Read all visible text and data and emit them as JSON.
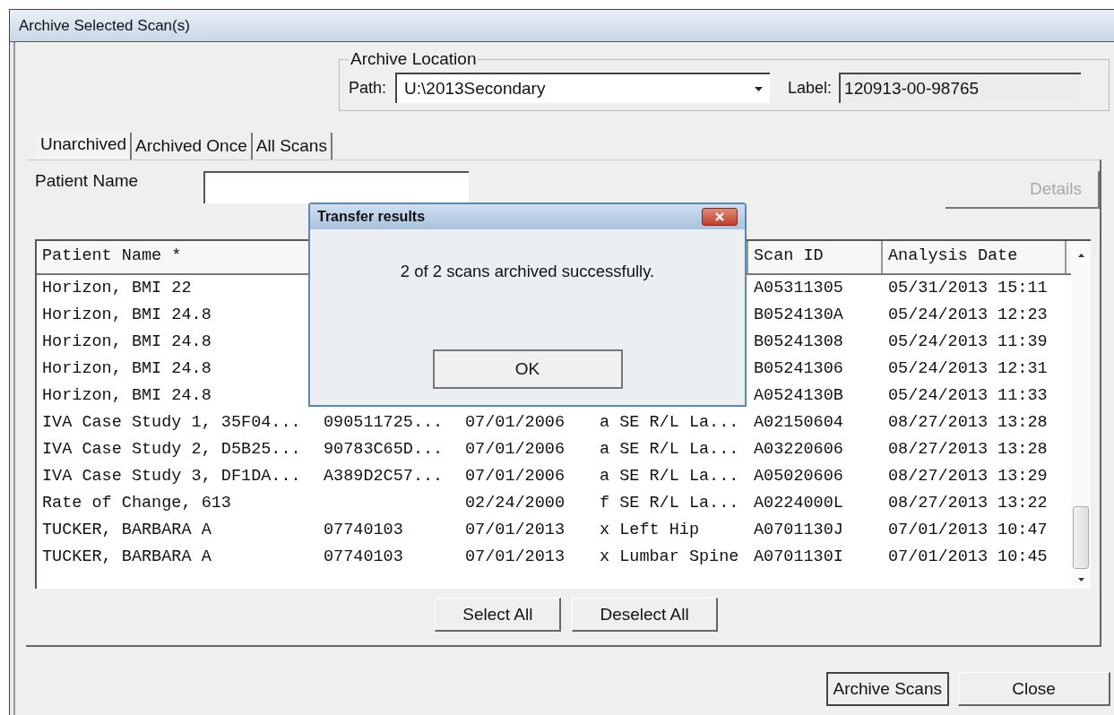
{
  "window": {
    "title": "Archive Selected Scan(s)"
  },
  "archive_location": {
    "title": "Archive Location",
    "path_label": "Path:",
    "path_value": "U:\\2013Secondary",
    "label_label": "Label:",
    "label_value": "120913-00-98765"
  },
  "tabs": [
    {
      "label": "Unarchived",
      "selected": true
    },
    {
      "label": "Archived Once",
      "selected": false
    },
    {
      "label": "All Scans",
      "selected": false
    }
  ],
  "filter": {
    "label": "Patient Name"
  },
  "details_button": {
    "label": "Details",
    "disabled": true
  },
  "table": {
    "headers": {
      "patient_name": "Patient Name *",
      "scan_id": "Scan ID",
      "analysis_date": "Analysis Date"
    },
    "rows": [
      {
        "patient_name": "Horizon, BMI 22",
        "scan_id": "A05311305",
        "analysis_date": "05/31/2013 15:11"
      },
      {
        "patient_name": "Horizon, BMI 24.8",
        "scan_id": "B0524130A",
        "analysis_date": "05/24/2013 12:23"
      },
      {
        "patient_name": "Horizon, BMI 24.8",
        "scan_id": "B05241308",
        "analysis_date": "05/24/2013 11:39"
      },
      {
        "patient_name": "Horizon, BMI 24.8",
        "scan_id": "B05241306",
        "analysis_date": "05/24/2013 12:31"
      },
      {
        "patient_name": "Horizon, BMI 24.8",
        "scan_id": "A0524130B",
        "analysis_date": "05/24/2013 11:33"
      },
      {
        "patient_name": "IVA Case Study 1, 35F04...",
        "column_2": "090511725...",
        "column_3": "07/01/2006",
        "column_4": "a SE R/L La...",
        "scan_id": "A02150604",
        "analysis_date": "08/27/2013 13:28"
      },
      {
        "patient_name": "IVA Case Study 2, D5B25...",
        "column_2": "90783C65D...",
        "column_3": "07/01/2006",
        "column_4": "a SE R/L La...",
        "scan_id": "A03220606",
        "analysis_date": "08/27/2013 13:28"
      },
      {
        "patient_name": "IVA Case Study 3, DF1DA...",
        "column_2": "A389D2C57...",
        "column_3": "07/01/2006",
        "column_4": "a SE R/L La...",
        "scan_id": "A05020606",
        "analysis_date": "08/27/2013 13:29"
      },
      {
        "patient_name": "Rate of Change, 613",
        "column_3": "02/24/2000",
        "column_4": "f SE R/L La...",
        "scan_id": "A0224000L",
        "analysis_date": "08/27/2013 13:22"
      },
      {
        "patient_name": "TUCKER, BARBARA A",
        "column_2": "07740103",
        "column_3": "07/01/2013",
        "column_4": "x Left Hip",
        "scan_id": "A0701130J",
        "analysis_date": "07/01/2013 10:47"
      },
      {
        "patient_name": "TUCKER, BARBARA A",
        "column_2": "07740103",
        "column_3": "07/01/2013",
        "column_4": "x Lumbar Spine",
        "scan_id": "A0701130I",
        "analysis_date": "07/01/2013 10:45"
      }
    ]
  },
  "list_buttons": [
    "Select All",
    "Deselect All"
  ],
  "footer_buttons": [
    "Archive Scans",
    "Close"
  ],
  "dialog": {
    "title": "Transfer results",
    "message": "2 of 2 scans archived successfully.",
    "button": "OK"
  }
}
